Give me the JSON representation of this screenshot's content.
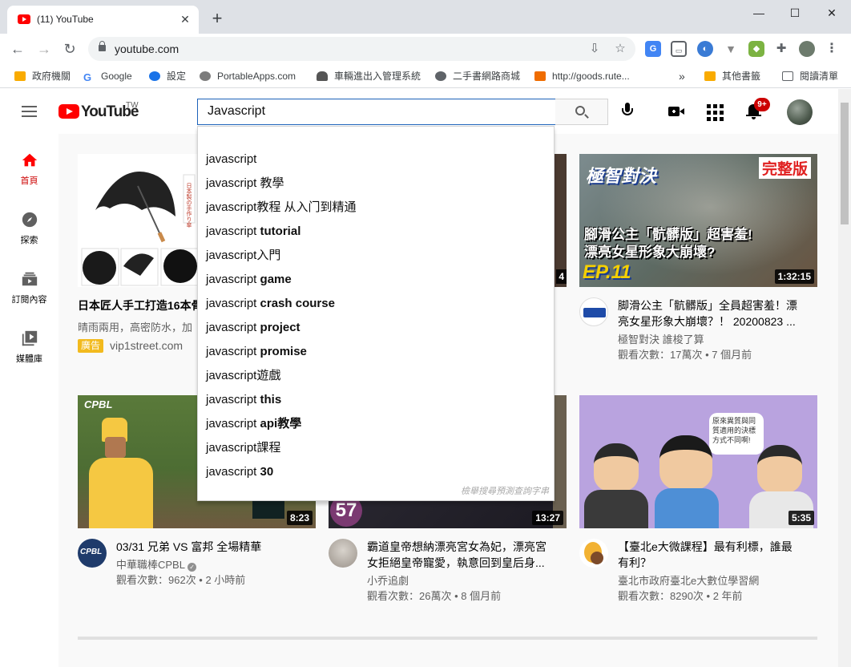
{
  "browser": {
    "tab_title": "(11) YouTube",
    "url": "youtube.com",
    "bookmarks": [
      "政府機關",
      "Google",
      "設定",
      "PortableApps.com",
      "車輛進出入管理系統",
      "二手書網路商城",
      "http://goods.rute...",
      "»",
      "其他書籤",
      "閱讀清單"
    ]
  },
  "youtube": {
    "logo_text": "YouTube",
    "country_code": "TW",
    "search_value": "Javascript",
    "notification_count": "9+",
    "guide": [
      "首頁",
      "探索",
      "訂閱內容",
      "媒體庫"
    ]
  },
  "suggestions": {
    "query_prefix": "javascript",
    "items": [
      {
        "suffix": ""
      },
      {
        "suffix": " 教學"
      },
      {
        "suffix": "教程 从入门到精通"
      },
      {
        "suffix": " tutorial"
      },
      {
        "suffix": "入門"
      },
      {
        "suffix": " game"
      },
      {
        "suffix": " crash course"
      },
      {
        "suffix": " project"
      },
      {
        "suffix": " promise"
      },
      {
        "suffix": "遊戲"
      },
      {
        "suffix": " this"
      },
      {
        "suffix": " api教學"
      },
      {
        "suffix": "課程"
      },
      {
        "suffix": " 30"
      }
    ],
    "footer": "檢舉搜尋預測查詢字串"
  },
  "videos": [
    {
      "title": "日本匠人手工打造16本骨",
      "desc": "晴雨兩用，高密防水，加",
      "ad_label": "廣告",
      "domain": "vip1street.com"
    },
    {
      "title": "脚滑公主「骯髒版」全員超害羞！漂",
      "title2": "亮女星形象大崩壞？！ 20200823 ...",
      "channel": "極智對決 誰梭了算",
      "meta": "觀看次數：17萬次 • 7 個月前",
      "duration": "1:32:15",
      "thumb_text": "腳滑公主「骯髒版」超害羞!",
      "thumb_text2": "漂亮女星形象大崩壞?",
      "thumb_banner": "完整版",
      "thumb_logo": "極智對決",
      "thumb_ep": "EP.11"
    },
    {
      "title": "03/31 兄弟 VS 富邦 全場精華",
      "channel": "中華職棒CPBL",
      "meta": "觀看次數：962次 • 2 小時前",
      "duration": "8:23",
      "avatar_text": "CPBL"
    },
    {
      "title": "霸道皇帝想納漂亮宮女為妃，漂亮宮",
      "title2": "女拒絕皇帝寵愛，執意回到皇后身...",
      "channel": "小乔追劇",
      "meta": "觀看次數：26萬次 • 8 個月前",
      "duration": "13:27",
      "thumb_num": "57"
    },
    {
      "title": "【臺北e大微課程】最有利標，誰最",
      "title2": "有利？",
      "channel": "臺北市政府臺北e大數位學習網",
      "meta": "觀看次數：8290次 • 2 年前",
      "duration": "5:35",
      "thumb_bubble": "原來異質與同質適用的決標方式不同啊!"
    }
  ],
  "colors": {
    "accent": "#ff0000",
    "search_border": "#1c62b9",
    "ad_badge": "#f2ba1e"
  }
}
